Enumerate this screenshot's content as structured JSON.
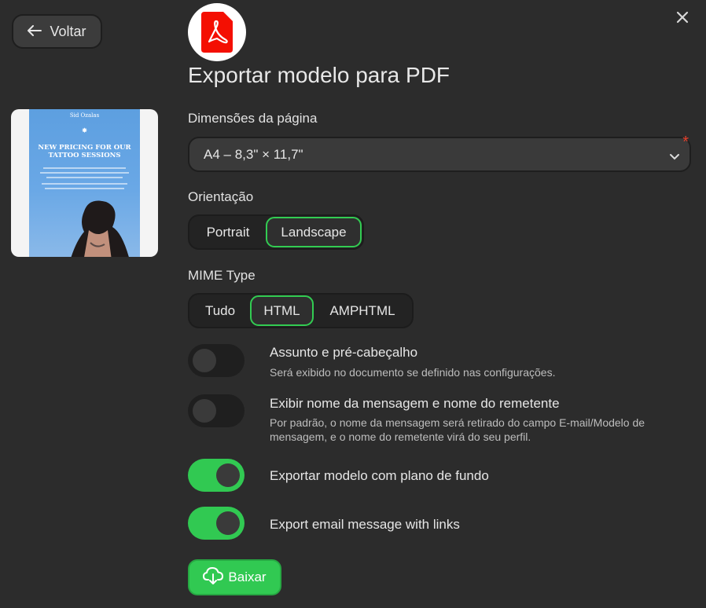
{
  "header": {
    "back_label": "Voltar",
    "title": "Exportar modelo para PDF"
  },
  "icons": {
    "back": "arrow-left-icon",
    "close": "close-icon",
    "logo": "adobe-pdf-icon",
    "download": "cloud-download-icon"
  },
  "preview": {
    "brand": "Sid Ozalas",
    "heading": "NEW PRICING FOR OUR TATTOO SESSIONS"
  },
  "page_size": {
    "label": "Dimensões da página",
    "value": "A4 – 8,3\" × 11,7\"",
    "required_mark": "*"
  },
  "orientation": {
    "label": "Orientação",
    "options": [
      "Portrait",
      "Landscape"
    ],
    "selected": "Landscape"
  },
  "mime": {
    "label": "MIME Type",
    "options": [
      "Tudo",
      "HTML",
      "AMPHTML"
    ],
    "selected": "HTML"
  },
  "options": [
    {
      "title": "Assunto e pré-cabeçalho",
      "description": "Será exibido no documento se definido nas configurações.",
      "enabled": false
    },
    {
      "title": "Exibir nome da mensagem e nome do remetente",
      "description": "Por padrão, o nome da mensagem será retirado do campo E-mail/Modelo de mensagem, e o nome do remetente virá do seu perfil.",
      "enabled": false
    },
    {
      "title": "Exportar modelo com plano de fundo",
      "description": "",
      "enabled": true
    },
    {
      "title": "Export email message with links",
      "description": "",
      "enabled": true
    }
  ],
  "download_label": "Baixar",
  "colors": {
    "background": "#2c2c2c",
    "accent": "#31c952",
    "pdf_red": "#f40f02",
    "required": "#e5412d"
  }
}
